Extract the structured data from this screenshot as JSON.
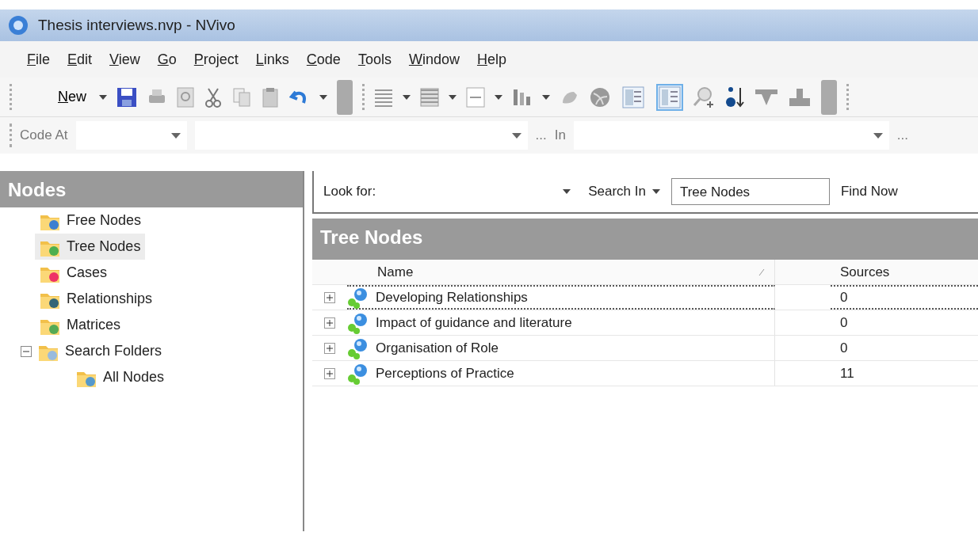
{
  "window": {
    "title": "Thesis interviews.nvp - NVivo"
  },
  "menu": [
    "File",
    "Edit",
    "View",
    "Go",
    "Project",
    "Links",
    "Code",
    "Tools",
    "Window",
    "Help"
  ],
  "toolbar": {
    "new_label": "New",
    "view_toggles": [
      {
        "selected": false
      },
      {
        "selected": true
      }
    ]
  },
  "code_bar": {
    "label": "Code At",
    "more_1": "...",
    "in_label": "In",
    "more_2": "..."
  },
  "sidebar": {
    "title": "Nodes",
    "items": [
      {
        "label": "Free Nodes",
        "kind": "free",
        "selected": false
      },
      {
        "label": "Tree Nodes",
        "kind": "tree",
        "selected": true
      },
      {
        "label": "Cases",
        "kind": "cases",
        "selected": false
      },
      {
        "label": "Relationships",
        "kind": "relationships",
        "selected": false
      },
      {
        "label": "Matrices",
        "kind": "matrices",
        "selected": false
      },
      {
        "label": "Search Folders",
        "kind": "search",
        "selected": false,
        "expanded": true,
        "children": [
          {
            "label": "All Nodes",
            "kind": "result",
            "selected": false
          }
        ]
      }
    ]
  },
  "search": {
    "look_for_label": "Look for:",
    "search_in_label": "Search In",
    "scope_value": "Tree Nodes",
    "find_button": "Find Now"
  },
  "list": {
    "title": "Tree Nodes",
    "columns": [
      "Name",
      "Sources"
    ],
    "rows": [
      {
        "name": "Developing Relationships",
        "sources": "0",
        "selected": true,
        "expanded": false
      },
      {
        "name": "Impact of guidance and literature",
        "sources": "0",
        "selected": false,
        "expanded": false
      },
      {
        "name": "Organisation of Role",
        "sources": "0",
        "selected": false,
        "expanded": false
      },
      {
        "name": "Perceptions of Practice",
        "sources": "11",
        "selected": false,
        "expanded": false
      }
    ]
  }
}
